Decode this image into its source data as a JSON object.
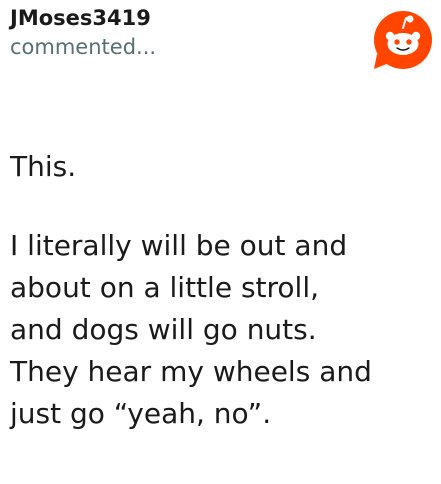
{
  "comment": {
    "username": "JMoses3419",
    "action": "commented...",
    "logo_icon": "reddit-snoo-icon",
    "brand_color": "#ff4500",
    "paragraphs": [
      "This.",
      "I literally will be out and\nabout on a little stroll,\nand dogs will go nuts.\nThey hear my wheels and\njust go “yeah, no”."
    ]
  }
}
